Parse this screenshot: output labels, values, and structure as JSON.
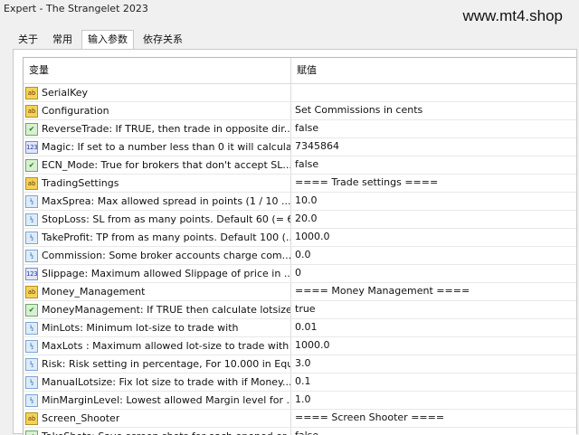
{
  "window": {
    "title": "Expert - The Strangelet 2023"
  },
  "watermark": "www.mt4.shop",
  "tabs": [
    {
      "label": "关于",
      "active": false
    },
    {
      "label": "常用",
      "active": false
    },
    {
      "label": "输入参数",
      "active": true
    },
    {
      "label": "依存关系",
      "active": false
    }
  ],
  "table": {
    "columns": {
      "variable": "变量",
      "value": "赋值"
    },
    "rows": [
      {
        "type": "ab",
        "icon": "string-type-icon",
        "name": "SerialKey",
        "value": ""
      },
      {
        "type": "ab",
        "icon": "string-type-icon",
        "name": "Configuration",
        "value": "Set Commissions in cents"
      },
      {
        "type": "bool",
        "icon": "bool-type-icon",
        "name": "ReverseTrade: If TRUE, then trade in opposite dir...",
        "value": "false"
      },
      {
        "type": "int",
        "icon": "int-type-icon",
        "name": "Magic: If set to a number less than 0 it will calcula...",
        "value": "7345864"
      },
      {
        "type": "bool",
        "icon": "bool-type-icon",
        "name": "ECN_Mode: True for brokers that don't accept SL...",
        "value": "false"
      },
      {
        "type": "ab",
        "icon": "string-type-icon",
        "name": "TradingSettings",
        "value": "==== Trade settings ===="
      },
      {
        "type": "dbl",
        "icon": "double-type-icon",
        "name": "MaxSprea: Max allowed spread in points (1 / 10 ...",
        "value": "10.0"
      },
      {
        "type": "dbl",
        "icon": "double-type-icon",
        "name": "StopLoss: SL from as many points. Default 60 (= 6...",
        "value": "20.0"
      },
      {
        "type": "dbl",
        "icon": "double-type-icon",
        "name": "TakeProfit: TP from as many points. Default 100 (...",
        "value": "1000.0"
      },
      {
        "type": "dbl",
        "icon": "double-type-icon",
        "name": "Commission: Some broker accounts charge com...",
        "value": "0.0"
      },
      {
        "type": "int",
        "icon": "int-type-icon",
        "name": "Slippage: Maximum allowed Slippage of price in ...",
        "value": "0"
      },
      {
        "type": "ab",
        "icon": "string-type-icon",
        "name": "Money_Management",
        "value": "==== Money Management ===="
      },
      {
        "type": "bool",
        "icon": "bool-type-icon",
        "name": "MoneyManagement: If TRUE then calculate lotsize...",
        "value": "true"
      },
      {
        "type": "dbl",
        "icon": "double-type-icon",
        "name": "MinLots: Minimum lot-size to trade with",
        "value": "0.01"
      },
      {
        "type": "dbl",
        "icon": "double-type-icon",
        "name": "MaxLots : Maximum allowed lot-size to trade with",
        "value": "1000.0"
      },
      {
        "type": "dbl",
        "icon": "double-type-icon",
        "name": "Risk: Risk setting in percentage, For 10.000 in Equ...",
        "value": "3.0"
      },
      {
        "type": "dbl",
        "icon": "double-type-icon",
        "name": "ManualLotsize: Fix lot size to trade with if Money...",
        "value": "0.1"
      },
      {
        "type": "dbl",
        "icon": "double-type-icon",
        "name": "MinMarginLevel: Lowest allowed Margin level for ...",
        "value": "1.0"
      },
      {
        "type": "ab",
        "icon": "string-type-icon",
        "name": "Screen_Shooter",
        "value": "==== Screen Shooter ===="
      },
      {
        "type": "bool",
        "icon": "bool-type-icon",
        "name": "TakeShots: Save screen shots for each opened or...",
        "value": "false"
      }
    ]
  }
}
